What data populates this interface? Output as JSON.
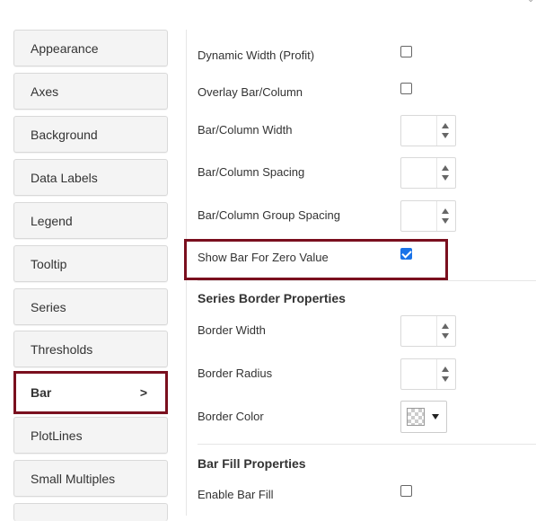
{
  "nav": {
    "items": [
      {
        "label": "Appearance"
      },
      {
        "label": "Axes"
      },
      {
        "label": "Background"
      },
      {
        "label": "Data Labels"
      },
      {
        "label": "Legend"
      },
      {
        "label": "Tooltip"
      },
      {
        "label": "Series"
      },
      {
        "label": "Thresholds"
      },
      {
        "label": "Bar",
        "active": true,
        "arrow": ">"
      },
      {
        "label": "PlotLines"
      },
      {
        "label": "Small Multiples"
      }
    ]
  },
  "bar_settings": {
    "dynamic_width_profit": {
      "label": "Dynamic Width (Profit)",
      "checked": false
    },
    "overlay_bar_column": {
      "label": "Overlay Bar/Column",
      "checked": false
    },
    "bar_column_width": {
      "label": "Bar/Column Width",
      "value": ""
    },
    "bar_column_spacing": {
      "label": "Bar/Column Spacing",
      "value": ""
    },
    "bar_column_group_spacing": {
      "label": "Bar/Column Group Spacing",
      "value": ""
    },
    "show_bar_for_zero_value": {
      "label": "Show Bar For Zero Value",
      "checked": true
    }
  },
  "series_border": {
    "title": "Series Border Properties",
    "border_width": {
      "label": "Border Width",
      "value": ""
    },
    "border_radius": {
      "label": "Border Radius",
      "value": ""
    },
    "border_color": {
      "label": "Border Color"
    }
  },
  "bar_fill": {
    "title": "Bar Fill Properties",
    "enable_bar_fill": {
      "label": "Enable Bar Fill",
      "checked": false
    }
  },
  "colors": {
    "highlight": "#7a0f1e",
    "checkbox_checked": "#1a73e8"
  }
}
